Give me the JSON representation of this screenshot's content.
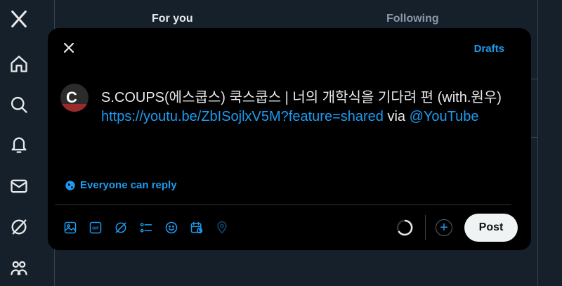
{
  "nav": {
    "items": [
      "x-logo-icon",
      "home-icon",
      "search-icon",
      "notifications-icon",
      "messages-icon",
      "grok-icon",
      "communities-icon"
    ]
  },
  "timeline": {
    "tabs": [
      {
        "label": "For you",
        "active": true
      },
      {
        "label": "Following",
        "active": false
      }
    ]
  },
  "composer": {
    "drafts_label": "Drafts",
    "text_plain_1": "S.COUPS(에스쿱스) 쿡스쿱스 | 너의 개학식을 기다려 편 (with.원우) ",
    "link_1": "https://youtu.be/ZbISojlxV5M?feature=shared",
    "text_plain_2": " via ",
    "mention": "@YouTube",
    "reply_setting": "Everyone can reply",
    "post_label": "Post",
    "toolbar_icons": [
      "media-icon",
      "gif-icon",
      "grok-icon",
      "poll-icon",
      "emoji-icon",
      "schedule-icon",
      "location-icon"
    ]
  },
  "colors": {
    "accent": "#1d9bf0",
    "background": "#15202b",
    "modal": "#000000"
  }
}
